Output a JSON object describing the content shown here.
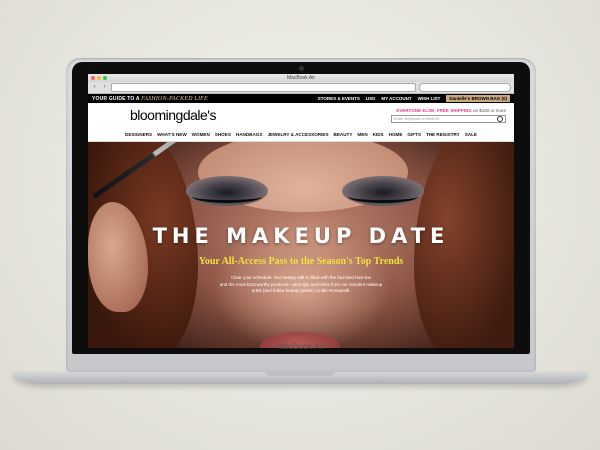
{
  "browser": {
    "window_title": "MacBook Air",
    "back_label": "‹",
    "forward_label": "›"
  },
  "laptop": {
    "model_label": "MacBook Air"
  },
  "site": {
    "promo": {
      "lead": "YOUR GUIDE TO A",
      "highlight": "FASHION-PACKED LIFE",
      "links": [
        "STORES & EVENTS",
        "USD",
        "MY ACCOUNT",
        "WISH LIST"
      ],
      "bag_label": "Danielle's BROWN BAG (0)"
    },
    "logo": "bloomingdale's",
    "shipping": {
      "label": "EVERYONE ELSE: FREE SHIPPING",
      "detail": "on $150 or more"
    },
    "search_placeholder": "Enter Keyword or Web ID",
    "categories": [
      "DESIGNERS",
      "WHAT'S NEW",
      "WOMEN",
      "SHOES",
      "HANDBAGS",
      "JEWELRY & ACCESSORIES",
      "BEAUTY",
      "MEN",
      "KIDS",
      "HOME",
      "GIFTS",
      "THE REGISTRY",
      "SALE"
    ]
  },
  "hero": {
    "title": "THE MAKEUP DATE",
    "subtitle": "Your All-Access Pass to the Season's Top Trends",
    "body_line1": "Clear your schedule: Our beauty edit is filled with the buzziest how-tos",
    "body_line2": "and the most buzzworthy products—plus tips and tricks from our resident makeup",
    "body_line3": "artist (and fellow beauty junkie) Cindle Romanelli."
  },
  "colors": {
    "accent_pink": "#e33a8a",
    "subtitle_yellow": "#f0e23a",
    "promo_gold": "#e8c7a2"
  }
}
